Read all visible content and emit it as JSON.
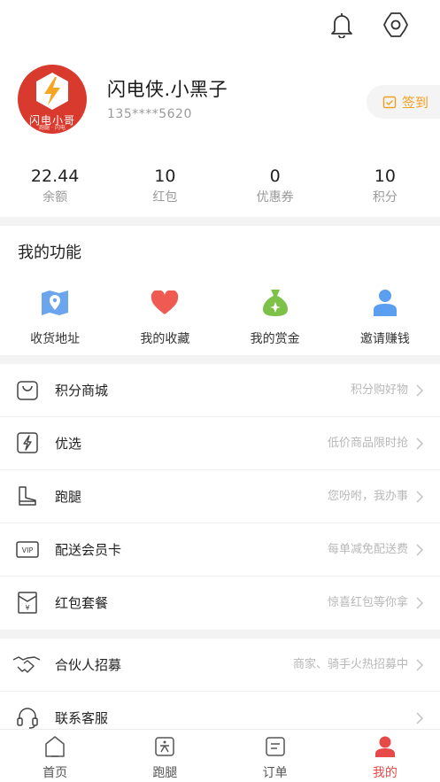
{
  "header": {
    "bell_icon": "bell-icon",
    "settings_icon": "gear-icon"
  },
  "profile": {
    "avatar_brand": "闪电小哥",
    "avatar_tagline": "跑腿 · 闪电",
    "name": "闪电侠.小黑子",
    "phone": "135****5620",
    "signin_label": "签到"
  },
  "stats": [
    {
      "value": "22.44",
      "label": "余额"
    },
    {
      "value": "10",
      "label": "红包"
    },
    {
      "value": "0",
      "label": "优惠券"
    },
    {
      "value": "10",
      "label": "积分"
    }
  ],
  "functions": {
    "title": "我的功能",
    "items": [
      {
        "label": "收货地址",
        "icon": "map-pin-icon"
      },
      {
        "label": "我的收藏",
        "icon": "heart-icon"
      },
      {
        "label": "我的赏金",
        "icon": "money-bag-icon"
      },
      {
        "label": "邀请赚钱",
        "icon": "user-icon"
      }
    ]
  },
  "menu1": [
    {
      "title": "积分商城",
      "sub": "积分购好物",
      "icon": "shopping-bag-icon"
    },
    {
      "title": "优选",
      "sub": "低价商品限时抢",
      "icon": "lightning-icon"
    },
    {
      "title": "跑腿",
      "sub": "您吩咐，我办事",
      "icon": "boot-icon"
    },
    {
      "title": "配送会员卡",
      "sub": "每单减免配送费",
      "icon": "vip-card-icon"
    },
    {
      "title": "红包套餐",
      "sub": "惊喜红包等你拿",
      "icon": "red-envelope-icon"
    }
  ],
  "menu2": [
    {
      "title": "合伙人招募",
      "sub": "商家、骑手火热招募中",
      "icon": "handshake-icon"
    },
    {
      "title": "联系客服",
      "sub": "",
      "icon": "headset-icon"
    }
  ],
  "tabs": [
    {
      "label": "首页",
      "icon": "home-icon"
    },
    {
      "label": "跑腿",
      "icon": "errand-icon"
    },
    {
      "label": "订单",
      "icon": "order-icon"
    },
    {
      "label": "我的",
      "icon": "profile-icon"
    }
  ],
  "colors": {
    "accent": "#e84a4a",
    "signin": "#f0a020",
    "avatar_bg": "#d83a2e"
  }
}
